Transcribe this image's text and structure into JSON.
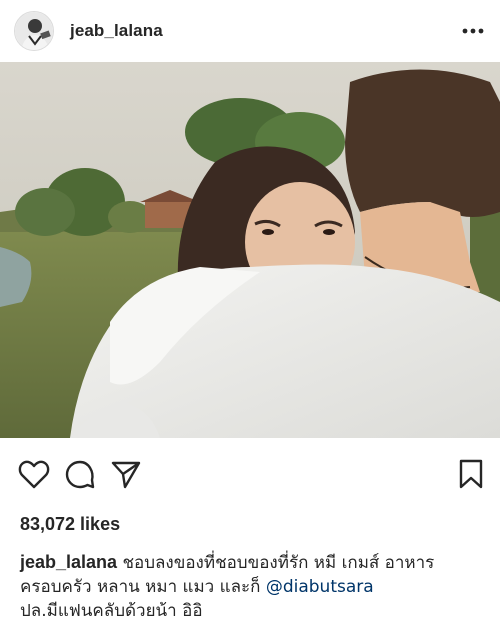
{
  "post": {
    "username": "jeab_lalana",
    "likes_text": "83,072 likes",
    "caption": {
      "username": "jeab_lalana",
      "line1_text": "ชอบลงของที่ชอบของที่รัก หมี เกมส์ อาหาร",
      "line2_text": "ครอบครัว หลาน หมา แมว และก็ ",
      "mention": "@diabutsara",
      "line3_text": "ปล.มีแฟนคลับด้วยน้า อิอิ"
    }
  },
  "icons": {
    "avatar": "profile-avatar",
    "more": "more-options-icon",
    "like": "heart-icon",
    "comment": "comment-icon",
    "share": "paper-plane-icon",
    "save": "bookmark-icon"
  },
  "colors": {
    "text": "#262626",
    "mention": "#003569",
    "background": "#ffffff"
  }
}
